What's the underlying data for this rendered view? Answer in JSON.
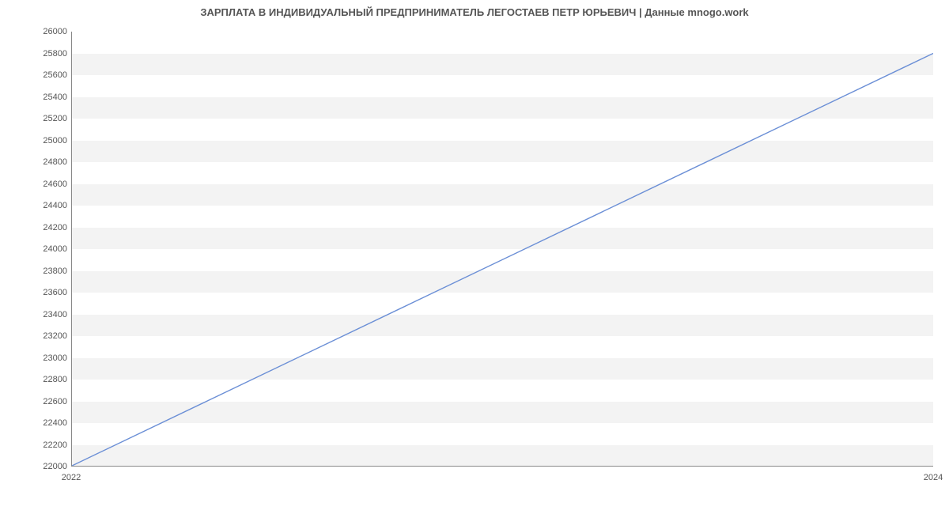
{
  "chart_data": {
    "type": "line",
    "title": "ЗАРПЛАТА В ИНДИВИДУАЛЬНЫЙ ПРЕДПРИНИМАТЕЛЬ ЛЕГОСТАЕВ ПЕТР ЮРЬЕВИЧ | Данные mnogo.work",
    "x": [
      2022,
      2024
    ],
    "y": [
      22000,
      25800
    ],
    "x_ticks": [
      2022,
      2024
    ],
    "y_ticks": [
      22000,
      22200,
      22400,
      22600,
      22800,
      23000,
      23200,
      23400,
      23600,
      23800,
      24000,
      24200,
      24400,
      24600,
      24800,
      25000,
      25200,
      25400,
      25600,
      25800,
      26000
    ],
    "ylim": [
      22000,
      26000
    ],
    "xlim": [
      2022,
      2024
    ],
    "xlabel": "",
    "ylabel": "",
    "line_color": "#6b8fd6",
    "band_color": "#f3f3f3"
  }
}
